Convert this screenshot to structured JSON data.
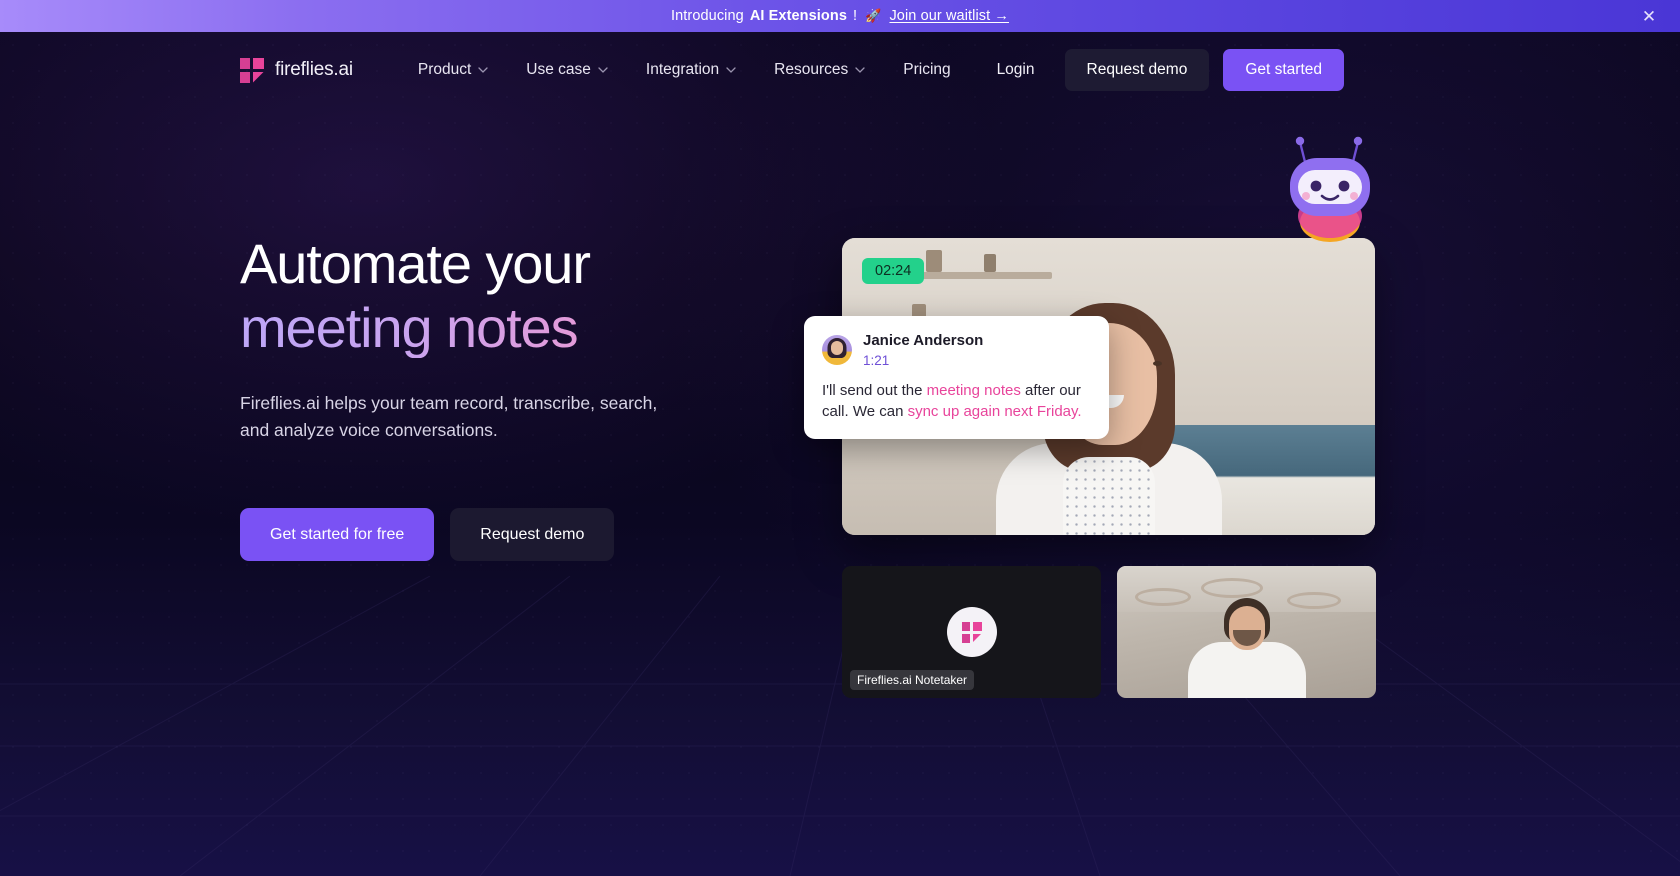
{
  "banner": {
    "intro": "Introducing",
    "strong": "AI Extensions",
    "exclaim": "!",
    "rocket": "🚀",
    "link": "Join our waitlist →",
    "close_icon": "✕"
  },
  "nav": {
    "logo_text": "fireflies.ai",
    "items": [
      {
        "label": "Product",
        "has_chevron": true
      },
      {
        "label": "Use case",
        "has_chevron": true
      },
      {
        "label": "Integration",
        "has_chevron": true
      },
      {
        "label": "Resources",
        "has_chevron": true
      },
      {
        "label": "Pricing",
        "has_chevron": false
      }
    ],
    "login": "Login",
    "request_demo": "Request demo",
    "get_started": "Get started"
  },
  "hero": {
    "headline_line1": "Automate your",
    "headline_line2": "meeting notes",
    "subhead": "Fireflies.ai helps your team record, transcribe, search, and analyze voice conversations.",
    "cta_primary": "Get started for free",
    "cta_secondary": "Request demo"
  },
  "visual": {
    "timer": "02:24",
    "notetaker_label": "Fireflies.ai Notetaker",
    "bubble": {
      "name": "Janice Anderson",
      "time": "1:21",
      "text_1": "I'll send out the ",
      "link_1": "meeting notes",
      "text_2": " after our call. We can ",
      "link_2": "sync up again next Friday."
    }
  },
  "colors": {
    "accent_purple": "#7a52f4",
    "accent_pink": "#e8449b",
    "timer_green": "#23d18b",
    "banner_start": "#a78bfa",
    "banner_end": "#4a36d6",
    "page_bg": "#0a0618"
  }
}
